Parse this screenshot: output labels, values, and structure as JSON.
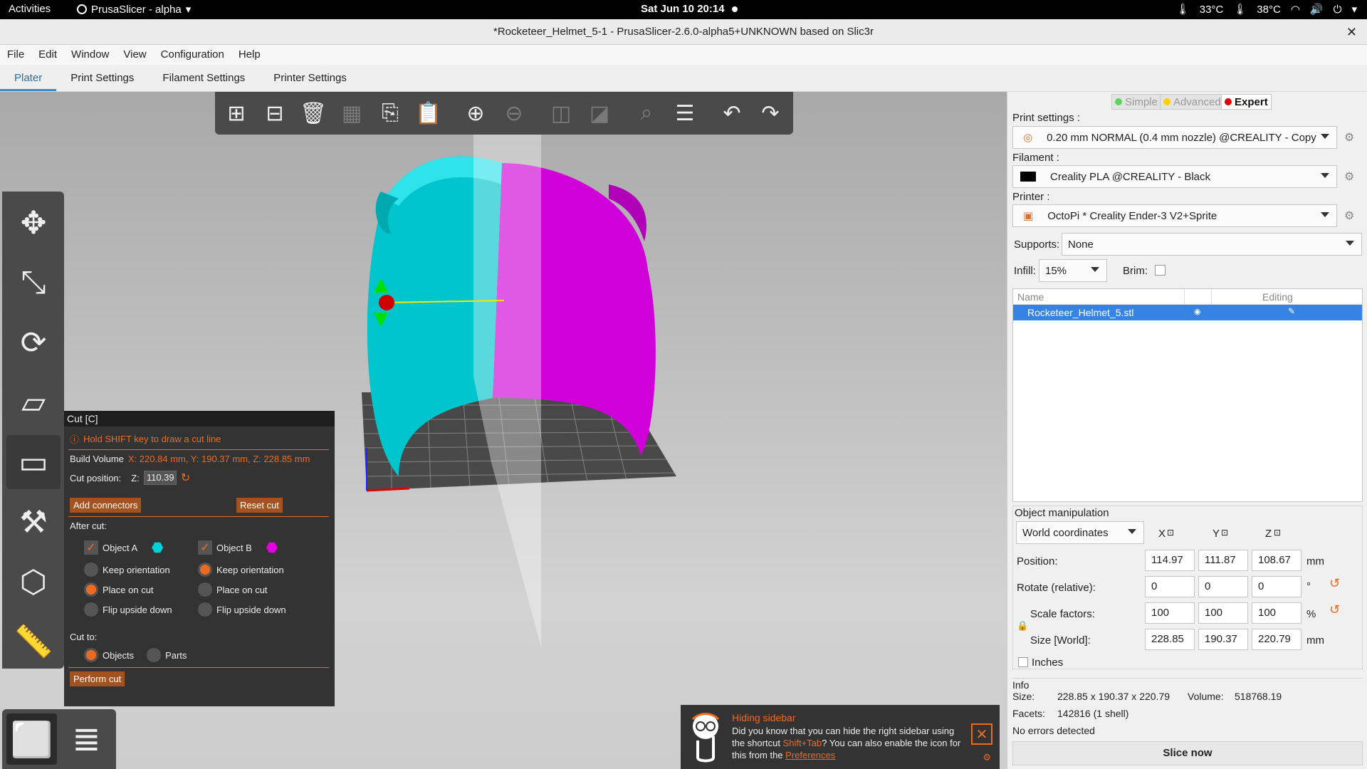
{
  "gnome": {
    "activities": "Activities",
    "app_menu": "PrusaSlicer - alpha",
    "clock": "Sat Jun 10  20:14",
    "temp1": "33°C",
    "temp2": "38°C"
  },
  "window": {
    "title": "*Rocketeer_Helmet_5-1 - PrusaSlicer-2.6.0-alpha5+UNKNOWN based on Slic3r"
  },
  "menu": [
    "File",
    "Edit",
    "Window",
    "View",
    "Configuration",
    "Help"
  ],
  "tabs": [
    "Plater",
    "Print Settings",
    "Filament Settings",
    "Printer Settings"
  ],
  "toolbar_icons": [
    "add-icon",
    "delete-icon",
    "delete-all-icon",
    "arrange-icon",
    "copy-icon",
    "paste-icon",
    "add-instance-icon",
    "remove-instance-icon",
    "split-objects-icon",
    "split-parts-icon",
    "search-icon",
    "layers-editing-icon",
    "undo-icon",
    "redo-icon"
  ],
  "cut": {
    "title": "Cut [C]",
    "hint": "Hold SHIFT key to draw a cut line",
    "build_volume_label": "Build Volume",
    "build_volume_value": "X: 220.84 mm,  Y: 190.37 mm,  Z: 228.85 mm",
    "cut_position_label": "Cut position:",
    "z_label": "Z:",
    "z_value": "110.39",
    "add_connectors": "Add connectors",
    "reset_cut": "Reset cut",
    "after_cut": "After cut:",
    "object_a": "Object A",
    "object_b": "Object B",
    "keep_orientation": "Keep orientation",
    "place_on_cut": "Place on cut",
    "flip_upside_down": "Flip upside down",
    "cut_to": "Cut to:",
    "objects": "Objects",
    "parts": "Parts",
    "perform_cut": "Perform cut",
    "color_a": "#00d0d8",
    "color_b": "#e000e0"
  },
  "notification": {
    "title": "Hiding sidebar",
    "text_1": "Did you know that you can hide the right sidebar using the shortcut ",
    "shortcut": "Shift+Tab",
    "text_2": "? You can also enable the icon for this from the ",
    "link": "Preferences"
  },
  "sidebar": {
    "modes": [
      "Simple",
      "Advanced",
      "Expert"
    ],
    "mode_colors": [
      "#5cd65c",
      "#ffd000",
      "#e00000"
    ],
    "print_settings_label": "Print settings :",
    "print_settings_value": "0.20 mm NORMAL (0.4 mm nozzle) @CREALITY - Copy",
    "filament_label": "Filament :",
    "filament_value": "Creality PLA @CREALITY - Black",
    "printer_label": "Printer :",
    "printer_value": "OctoPi * Creality Ender-3 V2+Sprite",
    "supports_label": "Supports:",
    "supports_value": "None",
    "infill_label": "Infill:",
    "infill_value": "15%",
    "brim_label": "Brim:",
    "list_header_name": "Name",
    "list_header_editing": "Editing",
    "object_name": "Rocketeer_Helmet_5.stl",
    "object_manipulation": "Object manipulation",
    "coords": "World coordinates",
    "axis_x": "X",
    "axis_y": "Y",
    "axis_z": "Z",
    "position_label": "Position:",
    "position": [
      "114.97",
      "111.87",
      "108.67"
    ],
    "position_unit": "mm",
    "rotate_label": "Rotate (relative):",
    "rotate": [
      "0",
      "0",
      "0"
    ],
    "rotate_unit": "°",
    "scale_label": "Scale factors:",
    "scale": [
      "100",
      "100",
      "100"
    ],
    "scale_unit": "%",
    "size_label": "Size [World]:",
    "size": [
      "228.85",
      "190.37",
      "220.79"
    ],
    "size_unit": "mm",
    "inches_label": "Inches",
    "info_label": "Info",
    "info_size_label": "Size:",
    "info_size": "228.85 x 190.37 x 220.79",
    "info_volume_label": "Volume:",
    "info_volume": "518768.19",
    "info_facets_label": "Facets:",
    "info_facets": "142816 (1 shell)",
    "info_errors": "No errors detected",
    "slice_now": "Slice now"
  }
}
